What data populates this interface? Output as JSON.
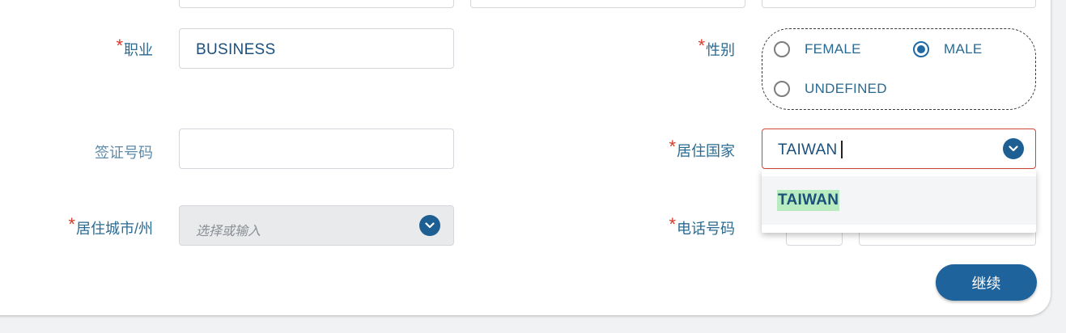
{
  "required_mark": "*",
  "occupation": {
    "label": "职业",
    "value": "BUSINESS"
  },
  "gender": {
    "label": "性别",
    "options": [
      {
        "label": "FEMALE",
        "checked": false
      },
      {
        "label": "MALE",
        "checked": true
      },
      {
        "label": "UNDEFINED",
        "checked": false
      }
    ]
  },
  "visa_number": {
    "label": "签证号码",
    "value": ""
  },
  "residence_country": {
    "label": "居住国家",
    "value": "TAIWAN",
    "suggestions": [
      "TAIWAN"
    ]
  },
  "residence_city": {
    "label": "居住城市/州",
    "placeholder": "选择或输入"
  },
  "phone_number": {
    "label": "电话号码"
  },
  "continue_button": {
    "label": "继续"
  },
  "colors": {
    "accent": "#1f639c",
    "required": "#d93a2b",
    "highlight": "#b8ecc0"
  }
}
